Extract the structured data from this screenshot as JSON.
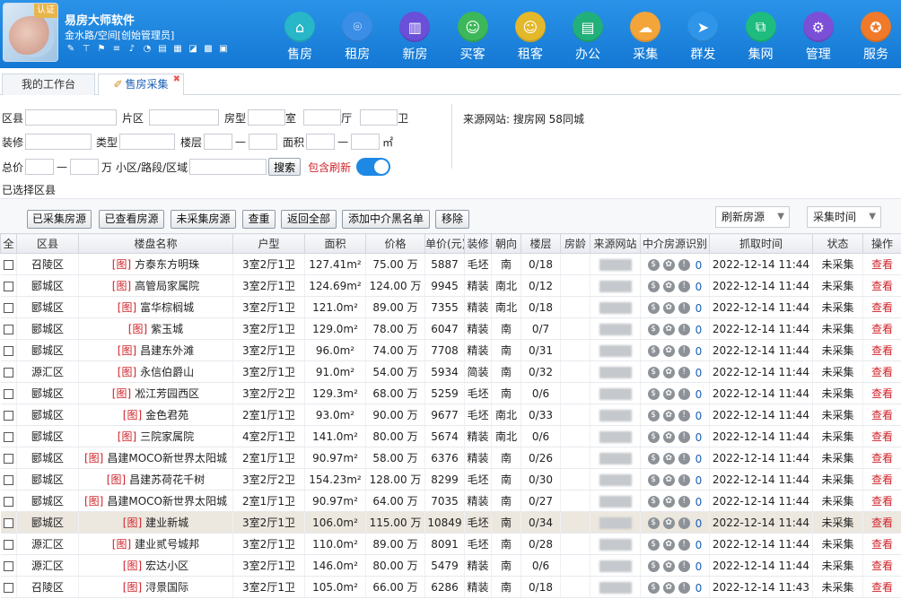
{
  "app": {
    "title": "易房大师软件",
    "subtitle": "金水路/空间[创始管理员]",
    "badge": "认证"
  },
  "nav": [
    {
      "label": "售房",
      "icon": "house-icon",
      "color": "#27b7c8",
      "glyph": "⌂"
    },
    {
      "label": "租房",
      "icon": "key-house-icon",
      "color": "#3a8ee6",
      "glyph": "⌾"
    },
    {
      "label": "新房",
      "icon": "building-icon",
      "color": "#6a4fd8",
      "glyph": "▥"
    },
    {
      "label": "买客",
      "icon": "user-icon",
      "color": "#3cb85a",
      "glyph": "☺"
    },
    {
      "label": "租客",
      "icon": "user-icon",
      "color": "#e3b82a",
      "glyph": "☺"
    },
    {
      "label": "办公",
      "icon": "printer-icon",
      "color": "#22b07a",
      "glyph": "▤"
    },
    {
      "label": "采集",
      "icon": "download-cloud-icon",
      "color": "#f3a53a",
      "glyph": "☁"
    },
    {
      "label": "群发",
      "icon": "send-icon",
      "color": "#2f95e8",
      "glyph": "➤"
    },
    {
      "label": "集网",
      "icon": "network-icon",
      "color": "#1ebc7e",
      "glyph": "⧉"
    },
    {
      "label": "管理",
      "icon": "gear-icon",
      "color": "#7b4fd6",
      "glyph": "⚙"
    },
    {
      "label": "服务",
      "icon": "service-icon",
      "color": "#f07a2a",
      "glyph": "✪"
    }
  ],
  "tabs": [
    {
      "label": "我的工作台"
    },
    {
      "label": "售房采集"
    }
  ],
  "filters": {
    "district": "区县",
    "area_zone": "片区",
    "layout": "房型",
    "room": "室",
    "hall": "厅",
    "bath": "卫",
    "decoration": "装修",
    "type": "类型",
    "floor": "楼层",
    "dash": "—",
    "size": "面积",
    "size_unit": "㎡",
    "total_price": "总价",
    "price_unit": "万",
    "community": "小区/路段/区域",
    "search": "搜索",
    "include_refresh": "包含刷新",
    "selected_district": "已选择区县",
    "source": "来源网站: 搜房网 58同城"
  },
  "actions": [
    {
      "label": "已采集房源"
    },
    {
      "label": "已查看房源"
    },
    {
      "label": "未采集房源"
    },
    {
      "label": "查重"
    },
    {
      "label": "返回全部"
    },
    {
      "label": "添加中介黑名单"
    },
    {
      "label": "移除"
    }
  ],
  "dropdowns": {
    "refresh": "刷新房源",
    "sort": "采集时间"
  },
  "table": {
    "headers": [
      "全",
      "区县",
      "楼盘名称",
      "户型",
      "面积",
      "价格",
      "单价(元)",
      "装修",
      "朝向",
      "楼层",
      "房龄",
      "来源网站",
      "中介房源识别",
      "抓取时间",
      "状态",
      "操作"
    ],
    "tag": "[图]",
    "rows": [
      {
        "district": "召陵区",
        "name": "方泰东方明珠",
        "layout": "3室2厅1卫",
        "area": "127.41m²",
        "price": "75.00 万",
        "unit": "5887",
        "deco": "毛坯",
        "orient": "南",
        "floor": "0/18",
        "age": "",
        "count": "0",
        "time": "2022-12-14 11:44",
        "status": "未采集",
        "op": "查看"
      },
      {
        "district": "郾城区",
        "name": "高管局家属院",
        "layout": "3室2厅1卫",
        "area": "124.69m²",
        "price": "124.00 万",
        "unit": "9945",
        "deco": "精装",
        "orient": "南北",
        "floor": "0/12",
        "age": "",
        "count": "0",
        "time": "2022-12-14 11:44",
        "status": "未采集",
        "op": "查看"
      },
      {
        "district": "郾城区",
        "name": "富华棕榈城",
        "layout": "3室2厅1卫",
        "area": "121.0m²",
        "price": "89.00 万",
        "unit": "7355",
        "deco": "精装",
        "orient": "南北",
        "floor": "0/18",
        "age": "",
        "count": "0",
        "time": "2022-12-14 11:44",
        "status": "未采集",
        "op": "查看"
      },
      {
        "district": "郾城区",
        "name": "紫玉城",
        "layout": "3室2厅1卫",
        "area": "129.0m²",
        "price": "78.00 万",
        "unit": "6047",
        "deco": "精装",
        "orient": "南",
        "floor": "0/7",
        "age": "",
        "count": "0",
        "time": "2022-12-14 11:44",
        "status": "未采集",
        "op": "查看"
      },
      {
        "district": "郾城区",
        "name": "昌建东外滩",
        "layout": "3室2厅1卫",
        "area": "96.0m²",
        "price": "74.00 万",
        "unit": "7708",
        "deco": "精装",
        "orient": "南",
        "floor": "0/31",
        "age": "",
        "count": "0",
        "time": "2022-12-14 11:44",
        "status": "未采集",
        "op": "查看"
      },
      {
        "district": "源汇区",
        "name": "永信伯爵山",
        "layout": "3室2厅1卫",
        "area": "91.0m²",
        "price": "54.00 万",
        "unit": "5934",
        "deco": "简装",
        "orient": "南",
        "floor": "0/32",
        "age": "",
        "count": "0",
        "time": "2022-12-14 11:44",
        "status": "未采集",
        "op": "查看"
      },
      {
        "district": "郾城区",
        "name": "凇江芳园西区",
        "layout": "3室2厅2卫",
        "area": "129.3m²",
        "price": "68.00 万",
        "unit": "5259",
        "deco": "毛坯",
        "orient": "南",
        "floor": "0/6",
        "age": "",
        "count": "0",
        "time": "2022-12-14 11:44",
        "status": "未采集",
        "op": "查看"
      },
      {
        "district": "郾城区",
        "name": "金色君苑",
        "layout": "2室1厅1卫",
        "area": "93.0m²",
        "price": "90.00 万",
        "unit": "9677",
        "deco": "毛坯",
        "orient": "南北",
        "floor": "0/33",
        "age": "",
        "count": "0",
        "time": "2022-12-14 11:44",
        "status": "未采集",
        "op": "查看"
      },
      {
        "district": "郾城区",
        "name": "三院家属院",
        "layout": "4室2厅1卫",
        "area": "141.0m²",
        "price": "80.00 万",
        "unit": "5674",
        "deco": "精装",
        "orient": "南北",
        "floor": "0/6",
        "age": "",
        "count": "0",
        "time": "2022-12-14 11:44",
        "status": "未采集",
        "op": "查看"
      },
      {
        "district": "郾城区",
        "name": "昌建MOCO新世界太阳城",
        "layout": "2室1厅1卫",
        "area": "90.97m²",
        "price": "58.00 万",
        "unit": "6376",
        "deco": "精装",
        "orient": "南",
        "floor": "0/26",
        "age": "",
        "count": "0",
        "time": "2022-12-14 11:44",
        "status": "未采集",
        "op": "查看"
      },
      {
        "district": "郾城区",
        "name": "昌建苏荷花千树",
        "layout": "3室2厅2卫",
        "area": "154.23m²",
        "price": "128.00 万",
        "unit": "8299",
        "deco": "毛坯",
        "orient": "南",
        "floor": "0/30",
        "age": "",
        "count": "0",
        "time": "2022-12-14 11:44",
        "status": "未采集",
        "op": "查看"
      },
      {
        "district": "郾城区",
        "name": "昌建MOCO新世界太阳城",
        "layout": "2室1厅1卫",
        "area": "90.97m²",
        "price": "64.00 万",
        "unit": "7035",
        "deco": "精装",
        "orient": "南",
        "floor": "0/27",
        "age": "",
        "count": "0",
        "time": "2022-12-14 11:44",
        "status": "未采集",
        "op": "查看"
      },
      {
        "district": "郾城区",
        "name": "建业新城",
        "layout": "3室2厅1卫",
        "area": "106.0m²",
        "price": "115.00 万",
        "unit": "10849",
        "deco": "毛坯",
        "orient": "南",
        "floor": "0/34",
        "age": "",
        "count": "0",
        "time": "2022-12-14 11:44",
        "status": "未采集",
        "op": "查看",
        "highlight": true
      },
      {
        "district": "源汇区",
        "name": "建业贰号城邦",
        "layout": "3室2厅1卫",
        "area": "110.0m²",
        "price": "89.00 万",
        "unit": "8091",
        "deco": "毛坯",
        "orient": "南",
        "floor": "0/28",
        "age": "",
        "count": "0",
        "time": "2022-12-14 11:44",
        "status": "未采集",
        "op": "查看"
      },
      {
        "district": "源汇区",
        "name": "宏达小区",
        "layout": "3室2厅1卫",
        "area": "146.0m²",
        "price": "80.00 万",
        "unit": "5479",
        "deco": "精装",
        "orient": "南",
        "floor": "0/6",
        "age": "",
        "count": "0",
        "time": "2022-12-14 11:44",
        "status": "未采集",
        "op": "查看"
      },
      {
        "district": "召陵区",
        "name": "浔景国际",
        "layout": "3室2厅1卫",
        "area": "105.0m²",
        "price": "66.00 万",
        "unit": "6286",
        "deco": "精装",
        "orient": "南",
        "floor": "0/18",
        "age": "",
        "count": "0",
        "time": "2022-12-14 11:43",
        "status": "未采集",
        "op": "查看"
      }
    ]
  }
}
